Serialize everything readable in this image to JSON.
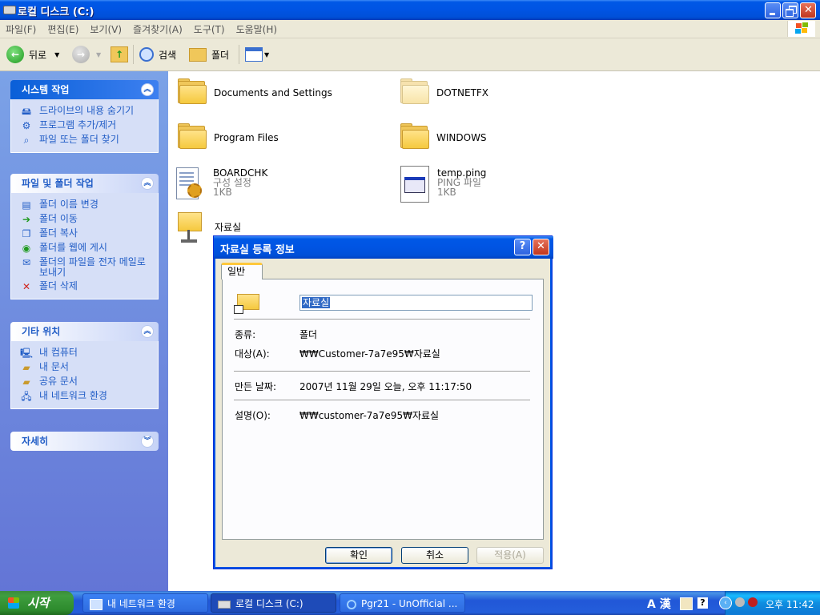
{
  "window": {
    "title": "로컬 디스크 (C:)",
    "minimize_label": "_",
    "restore_label": "❐",
    "close_label": "✕"
  },
  "menu": [
    "파일(F)",
    "편집(E)",
    "보기(V)",
    "즐겨찾기(A)",
    "도구(T)",
    "도움말(H)"
  ],
  "toolbar": {
    "back_label": "뒤로",
    "search_label": "검색",
    "folders_label": "폴더"
  },
  "left_pane": {
    "system_tasks": {
      "title": "시스템 작업",
      "items": [
        "드라이브의 내용 숨기기",
        "프로그램 추가/제거",
        "파일 또는 폴더 찾기"
      ]
    },
    "file_tasks": {
      "title": "파일 및 폴더 작업",
      "items": [
        "폴더 이름 변경",
        "폴더 이동",
        "폴더 복사",
        "폴더를 웹에 게시",
        "폴더의 파일을 전자 메일로 보내기",
        "폴더 삭제"
      ]
    },
    "other_places": {
      "title": "기타 위치",
      "items": [
        "내 컴퓨터",
        "내 문서",
        "공유 문서",
        "내 네트워크 환경"
      ]
    },
    "details": {
      "title": "자세히"
    }
  },
  "files": [
    {
      "name": "Documents and Settings",
      "icon": "folder-icon"
    },
    {
      "name": "DOTNETFX",
      "icon": "folder-icon"
    },
    {
      "name": "Program Files",
      "icon": "folder-icon"
    },
    {
      "name": "WINDOWS",
      "icon": "folder-icon"
    },
    {
      "name": "BOARDCHK",
      "type": "구성 설정",
      "size": "1KB",
      "icon": "config-file-icon"
    },
    {
      "name": "temp.ping",
      "type": "PING 파일",
      "size": "1KB",
      "icon": "generic-file-icon"
    },
    {
      "name": "자료실",
      "icon": "network-folder-icon"
    }
  ],
  "dialog": {
    "title": "자료실 등록 정보",
    "help_label": "?",
    "close_label": "✕",
    "tab": "일반",
    "name_value": "자료실",
    "type_label": "종류:",
    "type_value": "폴더",
    "target_label": "대상(A):",
    "target_value": "₩₩Customer-7a7e95₩자료실",
    "created_label": "만든 날짜:",
    "created_value": "2007년 11월 29일 오늘, 오후 11:17:50",
    "comment_label": "설명(O):",
    "comment_value": "₩₩customer-7a7e95₩자료실",
    "ok_label": "확인",
    "cancel_label": "취소",
    "apply_label": "적용(A)"
  },
  "taskbar": {
    "start_label": "시작",
    "tasks": [
      "내 네트워크 환경",
      "로컬 디스크 (C:)",
      "Pgr21 - UnOfficial ..."
    ],
    "lang_indicator": "A 漢",
    "clock": "오후 11:42"
  }
}
